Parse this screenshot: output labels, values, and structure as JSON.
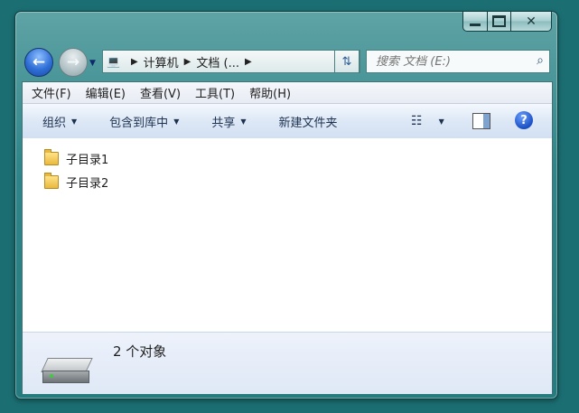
{
  "window": {
    "caption_buttons": {
      "minimize": "",
      "maximize": "",
      "close": "✕"
    }
  },
  "address_bar": {
    "breadcrumbs": [
      "计算机",
      "文档 (..."
    ],
    "drive_icon": "computer-icon"
  },
  "search": {
    "placeholder": "搜索 文档 (E:)"
  },
  "menubar": [
    "文件(F)",
    "编辑(E)",
    "查看(V)",
    "工具(T)",
    "帮助(H)"
  ],
  "toolbar": {
    "organize": "组织",
    "include_in_library": "包含到库中",
    "share": "共享",
    "new_folder": "新建文件夹",
    "views_icon": "views-icon",
    "preview_pane_icon": "preview-pane-icon",
    "help": "?"
  },
  "items": [
    {
      "name": "子目录1",
      "icon": "folder-icon"
    },
    {
      "name": "子目录2",
      "icon": "folder-icon"
    }
  ],
  "details": {
    "count": "2 个对象",
    "icon": "hard-drive-icon"
  },
  "colors": {
    "desktop": "#1b6f73",
    "window_frame": "#2f8589",
    "toolbar": "#dde8f6"
  }
}
